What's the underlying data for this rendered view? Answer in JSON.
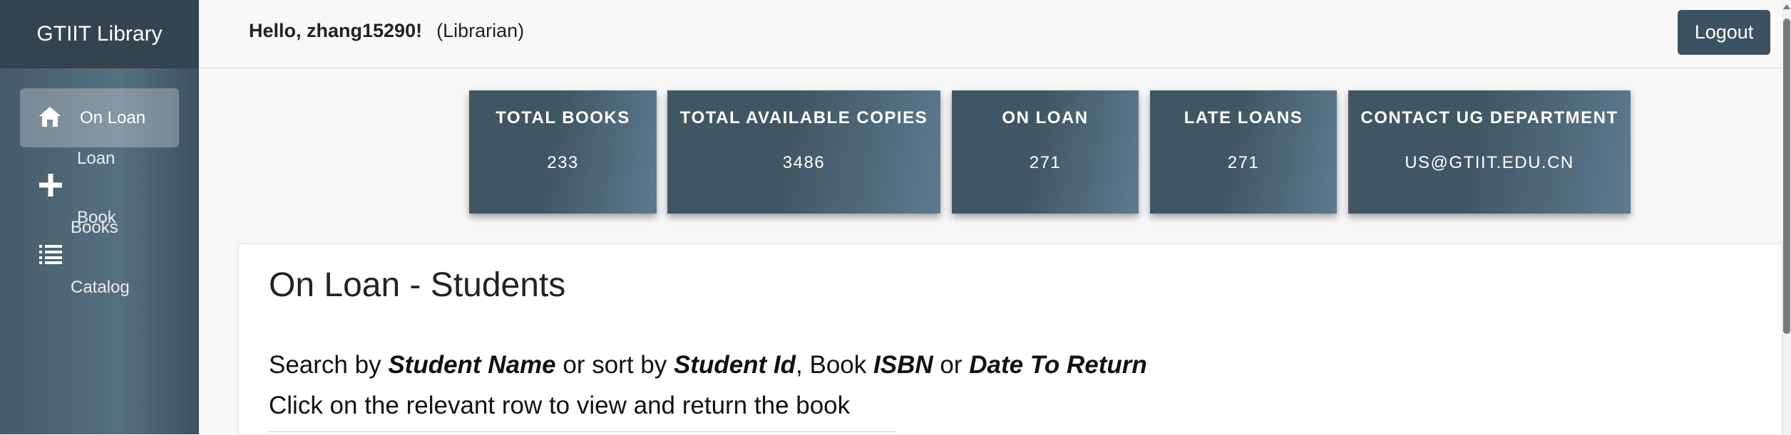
{
  "app": {
    "title": "GTIIT Library"
  },
  "header": {
    "greeting": "Hello, zhang15290!",
    "role": "(Librarian)",
    "logout_label": "Logout"
  },
  "sidebar": {
    "items": [
      {
        "label": "On Loan",
        "icon": "home-icon",
        "active": true
      },
      {
        "label_line1": "Loan",
        "label_line2": "Book",
        "icon": "plus-icon"
      },
      {
        "label_line1": "Books",
        "label_line2": "Catalog",
        "icon": "list-icon"
      }
    ]
  },
  "stats": [
    {
      "title": "TOTAL BOOKS",
      "value": "233"
    },
    {
      "title": "TOTAL AVAILABLE COPIES",
      "value": "3486"
    },
    {
      "title": "ON LOAN",
      "value": "271"
    },
    {
      "title": "LATE LOANS",
      "value": "271"
    },
    {
      "title": "CONTACT UG DEPARTMENT",
      "value": "US@GTIIT.EDU.CN"
    }
  ],
  "main": {
    "title": "On Loan - Students",
    "instructions": {
      "t1": "Search by ",
      "student_name": "Student Name",
      "t2": " or sort by ",
      "student_id": "Student Id",
      "t3": ", Book ",
      "isbn": "ISBN",
      "t4": " or ",
      "date_to_return": "Date To Return",
      "line2": "Click on the relevant row to view and return the book"
    }
  },
  "colors": {
    "sidebar_bg": "#4e6675",
    "brand_bg": "#34444f",
    "card_bg": "#415663",
    "logout_bg": "#3d5260"
  }
}
